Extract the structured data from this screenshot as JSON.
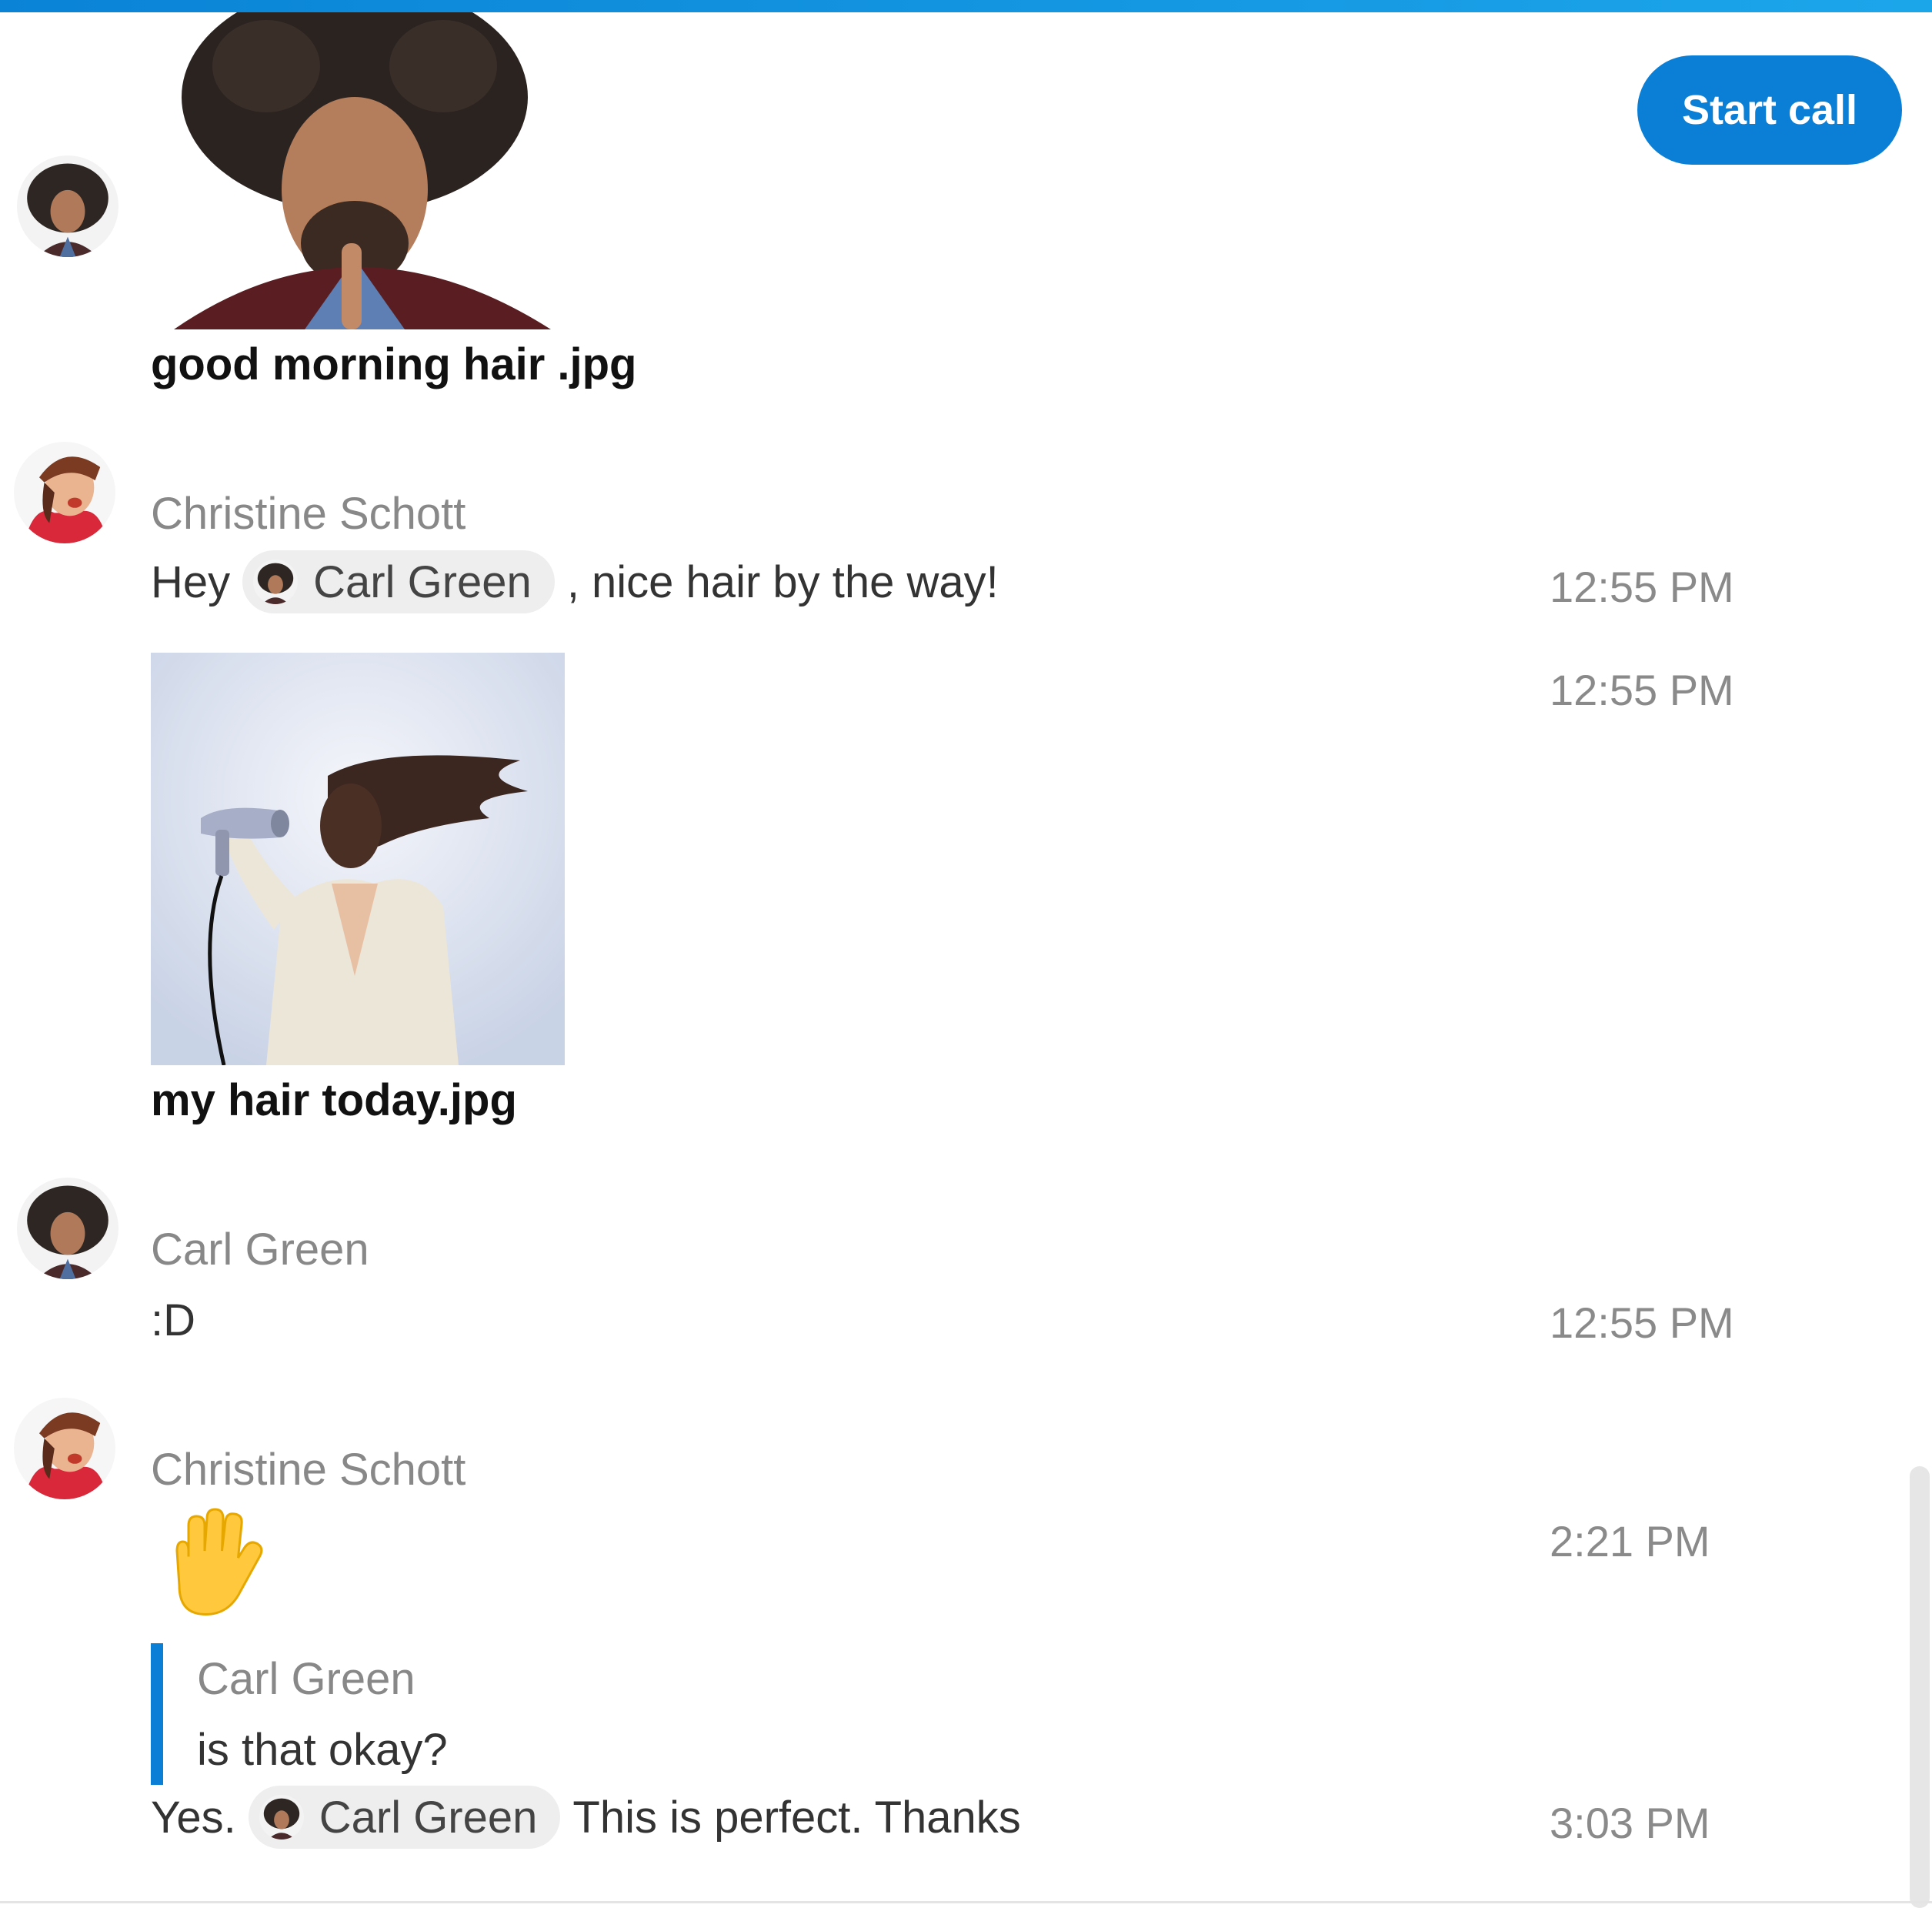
{
  "header": {
    "start_call_label": "Start call"
  },
  "messages": [
    {
      "kind": "file",
      "sender": "Carl Green",
      "file_name": "good morning hair .jpg"
    },
    {
      "kind": "text",
      "sender": "Christine Schott",
      "text_before": "Hey",
      "mention": "Carl Green",
      "text_after": ", nice hair by the way!",
      "time": "12:55 PM"
    },
    {
      "kind": "file",
      "sender": "Christine Schott",
      "file_name": "my hair today.jpg",
      "time": "12:55 PM"
    },
    {
      "kind": "text",
      "sender": "Carl Green",
      "text": ":D",
      "time": "12:55 PM"
    },
    {
      "kind": "emoji",
      "sender": "Christine Schott",
      "emoji": "raised-hand",
      "time": "2:21 PM"
    },
    {
      "kind": "reply",
      "sender": "Christine Schott",
      "quote_sender": "Carl Green",
      "quote_text": "is that okay?",
      "text_before": "Yes.",
      "mention": "Carl Green",
      "text_after": "This is perfect. Thanks",
      "time": "3:03 PM"
    }
  ],
  "colors": {
    "accent": "#0b7fd6",
    "timestamp": "#8a8a8a",
    "sender": "#888888",
    "mention_bg": "#eeeeee"
  }
}
